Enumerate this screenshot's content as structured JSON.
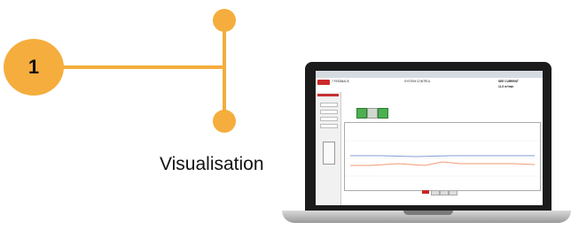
{
  "step": {
    "number": "1",
    "label": "Visualisation"
  },
  "colors": {
    "accent": "#f5ad3d",
    "line_blue": "#7f9ed0",
    "line_orange": "#f39a73"
  },
  "app": {
    "left_header": "7 FEEDBACK",
    "right_header": "11.5 m³/min",
    "title": "SYSTEM CONTROL",
    "right_title": "SEE CURRENT"
  }
}
